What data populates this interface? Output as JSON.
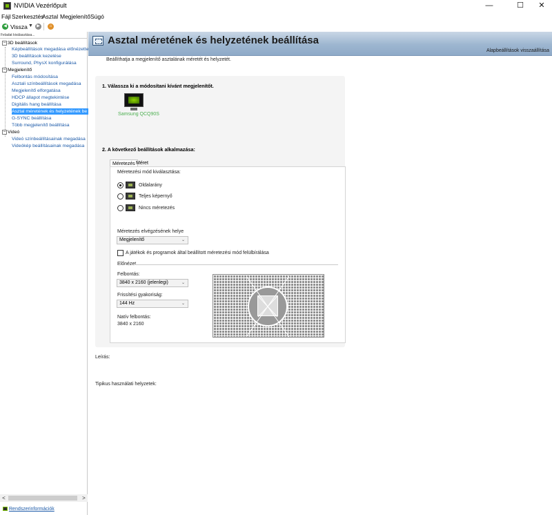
{
  "window": {
    "title": "NVIDIA Vezérlőpult",
    "minimize": "—",
    "maximize": "☐",
    "close": "✕"
  },
  "menu": [
    "Fájl",
    "Szerkesztés",
    "Asztal",
    "Megjelenítő",
    "Súgó"
  ],
  "toolbar": {
    "back_label": "Vissza"
  },
  "sidebar": {
    "header": "Feladat kiválasztása...",
    "categories": [
      {
        "label": "3D beállítások",
        "items": [
          "Képbeállítások megadása előnézette",
          "3D beállítások kezelése",
          "Surround, PhysX konfigurálása"
        ]
      },
      {
        "label": "Megjelenítő",
        "items": [
          "Felbontás módosítása",
          "Asztali színbeállítások megadása",
          "Megjelenítő elforgatása",
          "HDCP állapot megtekintése",
          "Digitális hang beállítása",
          "Asztal méretének és helyzetének be",
          "G-SYNC beállítása",
          "Több megjelenítő beállítása"
        ]
      },
      {
        "label": "Videó",
        "items": [
          "Videó színbeállításainak megadása",
          "Videókép beállításainak megadása"
        ]
      }
    ],
    "scroll_left": "<",
    "scroll_right": ">",
    "system_info": "Rendszerinformációk"
  },
  "page": {
    "title": "Asztal méretének és helyzetének beállítása",
    "restore_defaults": "Alapbeállítások visszaállítása",
    "intro": "Beállíthatja a megjelenítő asztalának méretét és helyzetét.",
    "step1": "1. Válassza ki a módosítani kívánt megjelenítőt.",
    "monitor_name": "Samsung QCQ90S",
    "step2": "2. A következő beállítások alkalmazása:",
    "tabs": [
      "Méretezés",
      "Méret"
    ],
    "scaling_mode_label": "Méretezési mód kiválasztása:",
    "scaling_options": [
      "Oldalarány",
      "Teljes képernyő",
      "Nincs méretezés"
    ],
    "selected_scaling": "Oldalarány",
    "perform_on_label": "Méretezés elvégzésének helye",
    "perform_on_value": "Megjelenítő",
    "override_label": "A játékok és programok által beállított méretezési mód felülbírálása",
    "override_checked": false,
    "preview_label": "Előnézet",
    "resolution_label": "Felbontás:",
    "resolution_value": "3840 x 2160 (jelenlegi)",
    "refresh_label": "Frissítési gyakoriság:",
    "refresh_value": "144 Hz",
    "native_label": "Natív felbontás:",
    "native_value": "3840 x 2160",
    "description_label": "Leírás:",
    "usage_label": "Tipikus használati helyzetek:"
  },
  "colors": {
    "accent_green": "#76b900",
    "link_blue": "#1c5aa8",
    "selection": "#3399ff",
    "header_blue": "#9db6d0"
  }
}
